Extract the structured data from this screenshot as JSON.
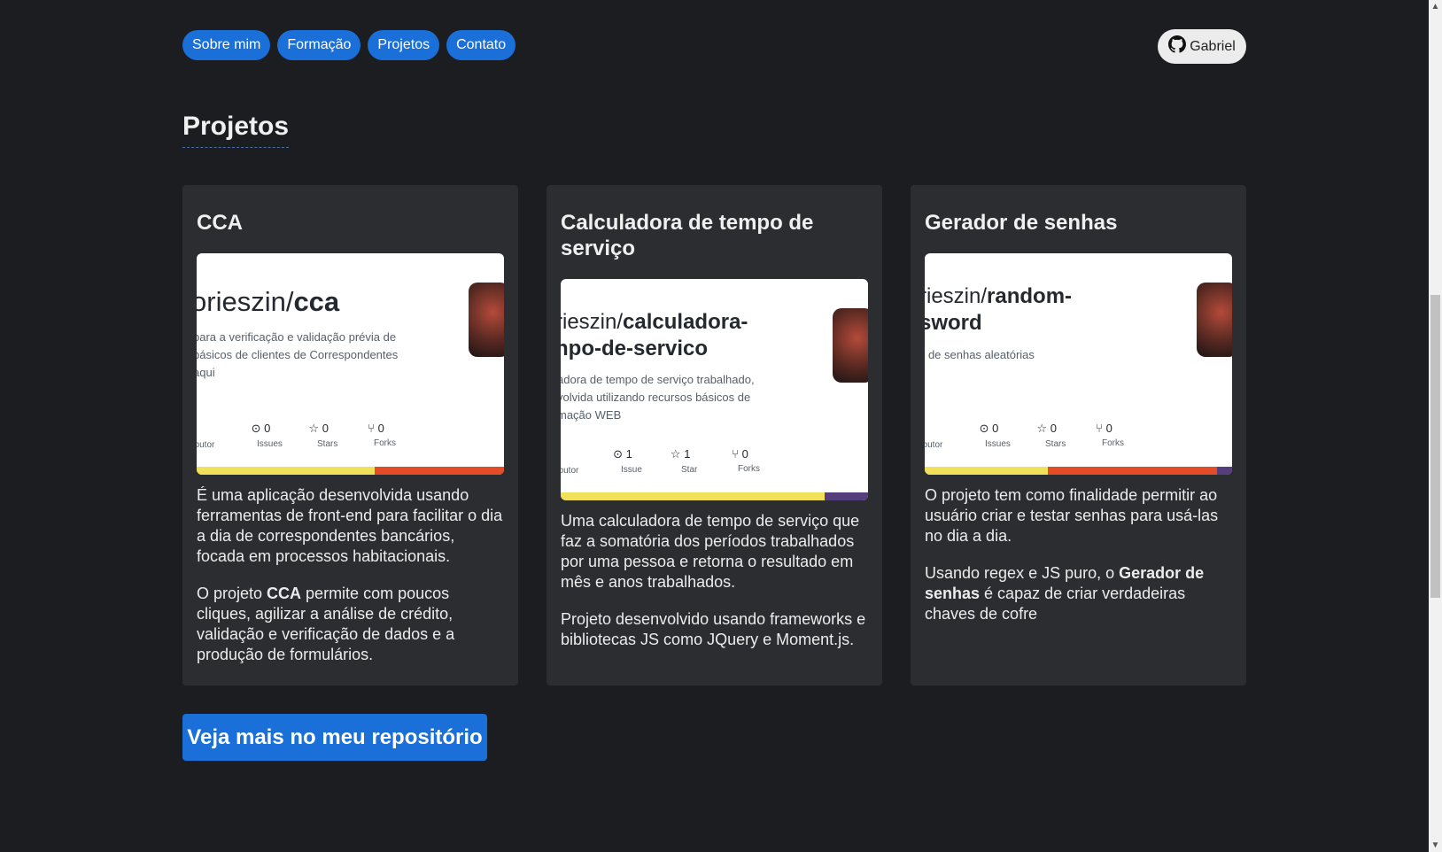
{
  "nav": {
    "items": [
      {
        "label": "Sobre mim"
      },
      {
        "label": "Formação"
      },
      {
        "label": "Projetos"
      },
      {
        "label": "Contato"
      }
    ],
    "github_label": "Gabriel"
  },
  "section_title": "Projetos",
  "cards": [
    {
      "title": "CCA",
      "preview": {
        "repo_prefix": "orieszin/",
        "repo_name": "cca",
        "desc_lines": [
          " para a verificação e validação prévia de",
          "básicos de clientes de Correspondentes",
          "aqui"
        ],
        "contributor_label": "ributor",
        "issues": "0",
        "issues_label": "Issues",
        "stars": "0",
        "stars_label": "Stars",
        "forks": "0",
        "forks_label": "Forks"
      },
      "para1": "É uma aplicação desenvolvida usando ferramentas de front-end para facilitar o dia a dia de correspondentes bancários, focada em processos habitacionais.",
      "para2_pre": "O projeto ",
      "para2_bold": "CCA",
      "para2_post": " permite com poucos cliques, agilizar a análise de crédito, validação e verificação de dados e a produção de formulários."
    },
    {
      "title": "Calculadora de tempo de serviço",
      "preview": {
        "repo_line1_prefix": "rieszin/",
        "repo_line1_name": "calculadora-",
        "repo_line2": "npo-de-servico",
        "desc_lines": [
          "adora de tempo de serviço trabalhado,",
          "volvida utilizando recursos básicos de",
          "mação WEB"
        ],
        "contributor_label": "ributor",
        "issues": "1",
        "issues_label": "Issue",
        "stars": "1",
        "stars_label": "Star",
        "forks": "0",
        "forks_label": "Forks"
      },
      "para1": "Uma calculadora de tempo de serviço que faz a somatória dos períodos trabalhados por uma pessoa e retorna o resultado em mês e anos trabalhados.",
      "para2": "Projeto desenvolvido usando frameworks e bibliotecas JS como JQuery e Moment.js."
    },
    {
      "title": "Gerador de senhas",
      "preview": {
        "repo_line1_prefix": "rieszin/",
        "repo_line1_name": "random-",
        "repo_line2": "sword",
        "desc_lines": [
          "r de senhas aleatórias"
        ],
        "contributor_label": "ributor",
        "issues": "0",
        "issues_label": "Issues",
        "stars": "0",
        "stars_label": "Stars",
        "forks": "0",
        "forks_label": "Forks"
      },
      "para1": "O projeto tem como finalidade permitir ao usuário criar e testar senhas para usá-las no dia a dia.",
      "para2_pre": "Usando regex e JS puro, o ",
      "para2_bold": "Gerador de senhas",
      "para2_post": " é capaz de criar verdadeiras chaves de cofre"
    }
  ],
  "cta_label": "Veja mais no meu repositório",
  "colors": {
    "background": "#1c1d21",
    "card": "#2c2d31",
    "accent": "#1a6fd8",
    "lang_js": "#f1e05a",
    "lang_html": "#e34c26",
    "lang_css": "#563d7c"
  }
}
